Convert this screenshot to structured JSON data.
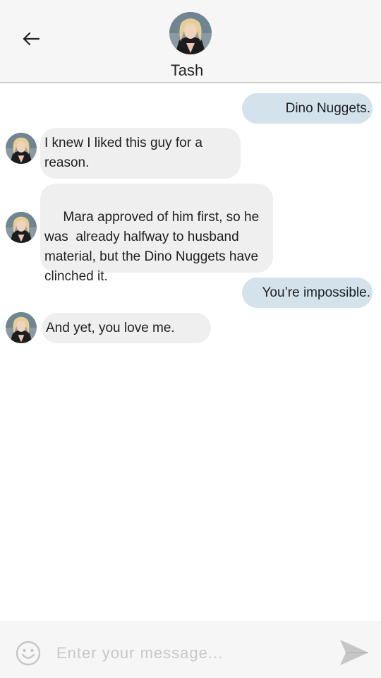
{
  "header": {
    "back_icon": "arrow-left-icon",
    "contact_name": "Tash",
    "avatar_icon": "contact-avatar"
  },
  "messages": [
    {
      "direction": "outgoing",
      "text": "Dino Nuggets."
    },
    {
      "direction": "incoming",
      "text": "I knew I liked this guy for a reason."
    },
    {
      "direction": "incoming",
      "text": " Mara approved of him first, so he was  already halfway to husband material, but the Dino Nuggets have clinched it."
    },
    {
      "direction": "outgoing",
      "text": "You’re impossible."
    },
    {
      "direction": "incoming",
      "text": "And yet, you love me."
    }
  ],
  "composer": {
    "placeholder": "Enter your message...",
    "value": "",
    "emoji_icon": "smiley-face-icon",
    "send_icon": "send-arrow-icon"
  },
  "colors": {
    "outgoing_bubble": "#d4e2ec",
    "incoming_bubble": "#efefef",
    "header_bg": "#f6f6f6",
    "icon_gray": "#c6c6c6"
  }
}
